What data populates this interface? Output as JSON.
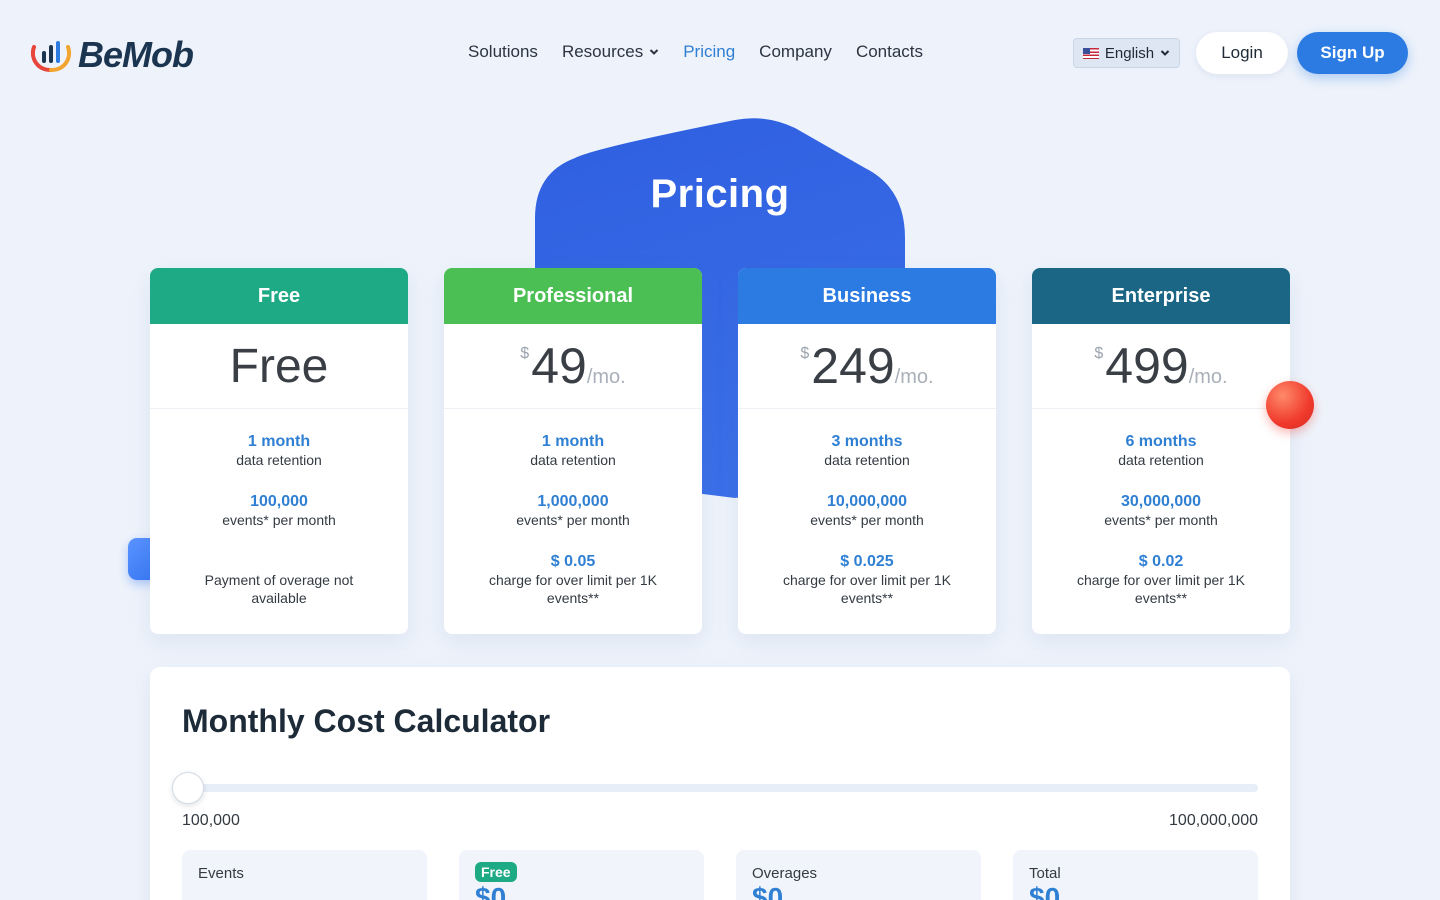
{
  "header": {
    "logo_text": "BeMob",
    "nav": [
      {
        "label": "Solutions"
      },
      {
        "label": "Resources"
      },
      {
        "label": "Pricing"
      },
      {
        "label": "Company"
      },
      {
        "label": "Contacts"
      }
    ],
    "language": "English",
    "login_label": "Login",
    "signup_label": "Sign Up"
  },
  "hero": {
    "title": "Pricing"
  },
  "plans": [
    {
      "name": "Free",
      "color": "#1faa86",
      "price_text": "Free",
      "features": [
        {
          "value": "1 month",
          "desc": "data retention"
        },
        {
          "value": "100,000",
          "desc": "events* per month"
        },
        {
          "value": "",
          "desc": "Payment of overage not available"
        }
      ]
    },
    {
      "name": "Professional",
      "color": "#4bbf53",
      "currency": "$",
      "amount": "49",
      "per": "/mo.",
      "features": [
        {
          "value": "1 month",
          "desc": "data retention"
        },
        {
          "value": "1,000,000",
          "desc": "events* per month"
        },
        {
          "value": "$ 0.05",
          "desc": "charge for over limit per 1K events**"
        }
      ]
    },
    {
      "name": "Business",
      "color": "#2b7be2",
      "currency": "$",
      "amount": "249",
      "per": "/mo.",
      "features": [
        {
          "value": "3 months",
          "desc": "data retention"
        },
        {
          "value": "10,000,000",
          "desc": "events* per month"
        },
        {
          "value": "$ 0.025",
          "desc": "charge for over limit per 1K events**"
        }
      ]
    },
    {
      "name": "Enterprise",
      "color": "#1b6585",
      "currency": "$",
      "amount": "499",
      "per": "/mo.",
      "features": [
        {
          "value": "6 months",
          "desc": "data retention"
        },
        {
          "value": "30,000,000",
          "desc": "events* per month"
        },
        {
          "value": "$ 0.02",
          "desc": "charge for over limit per 1K events**"
        }
      ]
    }
  ],
  "calculator": {
    "title": "Monthly Cost Calculator",
    "min": "100,000",
    "max": "100,000,000",
    "results": [
      {
        "label": "Events",
        "value": ""
      },
      {
        "badge": "Free",
        "value": "$0"
      },
      {
        "label": "Overages",
        "value": "$0"
      },
      {
        "label": "Total",
        "value": "$0"
      }
    ]
  }
}
